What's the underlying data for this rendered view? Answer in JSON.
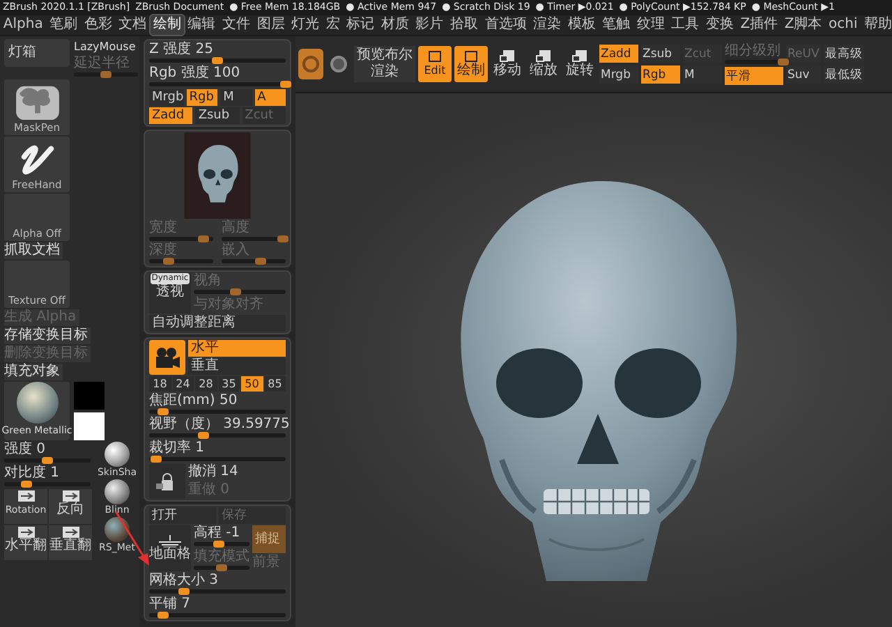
{
  "title_bar": {
    "app": "ZBrush 2020.1.1 [ZBrush]",
    "document": "ZBrush Document",
    "stats": [
      "● Free Mem 18.184GB",
      "● Active Mem 947",
      "● Scratch Disk 19",
      "● Timer ▶0.021",
      "● PolyCount ▶152.784 KP",
      "● MeshCount ▶1"
    ]
  },
  "menu": [
    {
      "label": "Alpha",
      "selected": false
    },
    {
      "label": "笔刷",
      "selected": false
    },
    {
      "label": "色彩",
      "selected": false
    },
    {
      "label": "文档",
      "selected": false
    },
    {
      "label": "绘制",
      "selected": true
    },
    {
      "label": "编辑",
      "selected": false
    },
    {
      "label": "文件",
      "selected": false
    },
    {
      "label": "图层",
      "selected": false
    },
    {
      "label": "灯光",
      "selected": false
    },
    {
      "label": "宏",
      "selected": false
    },
    {
      "label": "标记",
      "selected": false
    },
    {
      "label": "材质",
      "selected": false
    },
    {
      "label": "影片",
      "selected": false
    },
    {
      "label": "拾取",
      "selected": false
    },
    {
      "label": "首选项",
      "selected": false
    },
    {
      "label": "渲染",
      "selected": false
    },
    {
      "label": "模板",
      "selected": false
    },
    {
      "label": "笔触",
      "selected": false
    },
    {
      "label": "纹理",
      "selected": false
    },
    {
      "label": "工具",
      "selected": false
    },
    {
      "label": "变换",
      "selected": false
    },
    {
      "label": "Z插件",
      "selected": false
    },
    {
      "label": "Z脚本",
      "selected": false
    },
    {
      "label": "ochi",
      "selected": false
    },
    {
      "label": "帮助",
      "selected": false
    }
  ],
  "left_panel": {
    "lightbox": "灯箱",
    "lazymouse": {
      "label": "LazyMouse",
      "slider": {
        "label": "延迟半径",
        "level": 0.5,
        "disabled": true
      }
    },
    "brush": "MaskPen",
    "stroke": "FreeHand",
    "alpha": "Alpha Off",
    "grab_doc": "抓取文档",
    "texture": "Texture Off",
    "actions": [
      {
        "label": "生成 Alpha",
        "disabled": true
      },
      {
        "label": "存储变换目标",
        "disabled": false
      },
      {
        "label": "删除变换目标",
        "disabled": true
      }
    ],
    "fill": "填充对象",
    "material": "Green Metallic",
    "sliders": [
      {
        "label": "强度 0",
        "level": 0.5,
        "disabled": false
      },
      {
        "label": "对比度 1",
        "level": 0.25,
        "disabled": false
      }
    ],
    "tool_buttons": [
      "Rotation",
      "反向",
      "水平翻",
      "垂直翻"
    ],
    "materials": [
      "SkinSha",
      "Blinn",
      "RS_Met"
    ]
  },
  "draw_panel": {
    "sliders_top": [
      {
        "label": "Z 强度 25",
        "level": 0.5,
        "disabled": false
      },
      {
        "label": "Rgb 强度 100",
        "level": 1,
        "disabled": false
      }
    ],
    "color_modes": [
      {
        "label": "Mrgb",
        "on": false,
        "disabled": false
      },
      {
        "label": "Rgb",
        "on": true,
        "disabled": false
      },
      {
        "label": "M",
        "on": false,
        "disabled": false
      },
      {
        "label": "A",
        "on": true,
        "disabled": false
      }
    ],
    "depth_modes": [
      {
        "label": "Zadd",
        "on": true,
        "disabled": false
      },
      {
        "label": "Zsub",
        "on": false,
        "disabled": false
      },
      {
        "label": "Zcut",
        "on": false,
        "disabled": true
      }
    ],
    "preview_sliders": [
      {
        "label": "宽度",
        "level": 0.85,
        "disabled": true
      },
      {
        "label": "高度",
        "level": 0.95,
        "disabled": true
      },
      {
        "label": "深度",
        "level": 0.3,
        "disabled": true
      },
      {
        "label": "嵌入",
        "level": 0.6,
        "disabled": true
      }
    ],
    "perspective": {
      "badge": "Dynamic",
      "icon_label": "透视",
      "slider": {
        "label": "视角",
        "level": 0.45,
        "disabled": true
      },
      "align": {
        "label": "与对象对齐",
        "disabled": true
      },
      "auto_distance": "自动调整距离"
    },
    "camera": {
      "views": [
        {
          "label": "水平",
          "selected": true
        },
        {
          "label": "垂直",
          "selected": false
        }
      ],
      "focal_presets": [
        {
          "label": "18",
          "selected": false
        },
        {
          "label": "24",
          "selected": false
        },
        {
          "label": "28",
          "selected": false
        },
        {
          "label": "35",
          "selected": false
        },
        {
          "label": "50",
          "selected": true
        },
        {
          "label": "85",
          "selected": false
        }
      ],
      "sliders": [
        {
          "label": "焦距(mm) 50",
          "level": 0.1,
          "disabled": false
        },
        {
          "label": "视野（度） 39.59775",
          "level": 0.4,
          "disabled": false
        },
        {
          "label": "裁切率 1",
          "level": 0.05,
          "disabled": false
        }
      ],
      "history": [
        {
          "label": "撤消 14",
          "disabled": false
        },
        {
          "label": "重做 0",
          "disabled": true
        }
      ]
    },
    "floor": {
      "open": "打开",
      "save": {
        "label": "保存",
        "disabled": true
      },
      "icon_label": "地面格",
      "sliders": [
        {
          "label": "高程 -1",
          "level": 0.45,
          "disabled": false
        },
        {
          "label": "填充模式",
          "level": 0.5,
          "disabled": true
        }
      ],
      "snap": {
        "label": "捕捉",
        "on": true,
        "disabled": true
      },
      "front": {
        "label": "前景",
        "disabled": true
      },
      "grid": [
        {
          "label": "网格大小 3",
          "level": 0.25,
          "disabled": false
        },
        {
          "label": "平铺 7",
          "level": 0.1,
          "disabled": false
        }
      ]
    }
  },
  "toolbar": {
    "preview_button": "预览布尔渲染",
    "modes": [
      {
        "label": "Edit",
        "selected": true
      },
      {
        "label": "绘制",
        "selected": true
      }
    ],
    "transforms": [
      "移动",
      "缩放",
      "旋转"
    ],
    "depth_modes": [
      {
        "label": "Zadd",
        "on": true,
        "disabled": false
      },
      {
        "label": "Zsub",
        "on": false,
        "disabled": false
      },
      {
        "label": "Zcut",
        "on": false,
        "disabled": true
      }
    ],
    "color_modes": [
      {
        "label": "Mrgb",
        "on": false,
        "disabled": false
      },
      {
        "label": "Rgb",
        "on": true,
        "disabled": false
      },
      {
        "label": "M",
        "on": false,
        "disabled": false
      }
    ],
    "subdiv": {
      "label": "细分级别",
      "level": 1,
      "disabled": true
    },
    "smooth": {
      "label": "平滑",
      "on": true
    },
    "uv": [
      {
        "label": "ReUV",
        "on": false,
        "disabled": true
      },
      {
        "label": "Suv",
        "on": false,
        "disabled": false
      }
    ],
    "levels": [
      "最高级",
      "最低级"
    ]
  }
}
